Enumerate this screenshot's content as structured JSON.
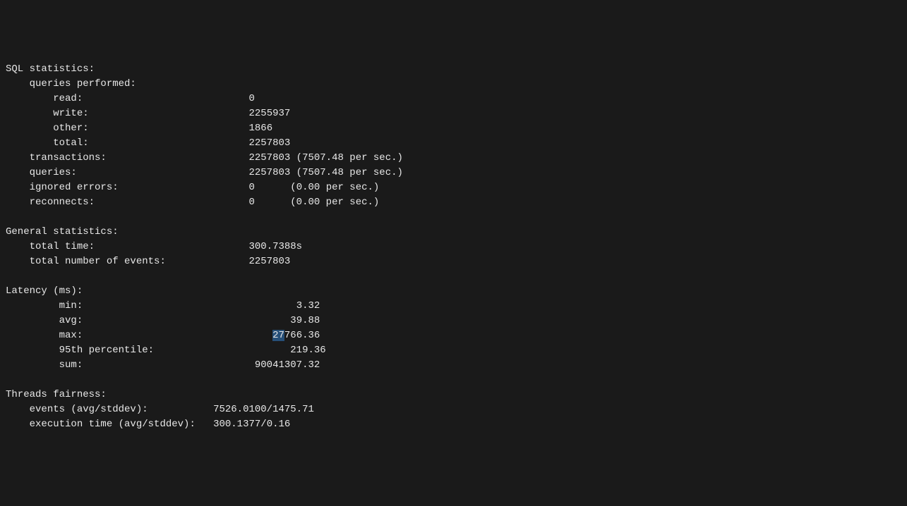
{
  "sql_stats": {
    "header": "SQL statistics:",
    "queries_performed": "queries performed:",
    "read_label": "read:",
    "read_value": "0",
    "write_label": "write:",
    "write_value": "2255937",
    "other_label": "other:",
    "other_value": "1866",
    "total_label": "total:",
    "total_value": "2257803",
    "transactions_label": "transactions:",
    "transactions_value": "2257803 (7507.48 per sec.)",
    "queries_label": "queries:",
    "queries_value": "2257803 (7507.48 per sec.)",
    "ignored_errors_label": "ignored errors:",
    "ignored_errors_value": "0      (0.00 per sec.)",
    "reconnects_label": "reconnects:",
    "reconnects_value": "0      (0.00 per sec.)"
  },
  "general_stats": {
    "header": "General statistics:",
    "total_time_label": "total time:",
    "total_time_value": "300.7388s",
    "total_events_label": "total number of events:",
    "total_events_value": "2257803"
  },
  "latency": {
    "header": "Latency (ms):",
    "min_label": "min:",
    "min_value": "3.32",
    "avg_label": "avg:",
    "avg_value": "39.88",
    "max_label": "max:",
    "max_value_sel": "27",
    "max_value_rest": "766.36",
    "p95_label": "95th percentile:",
    "p95_value": "219.36",
    "sum_label": "sum:",
    "sum_value": "90041307.32"
  },
  "threads": {
    "header": "Threads fairness:",
    "events_label": "events (avg/stddev):",
    "events_value": "7526.0100/1475.71",
    "exec_label": "execution time (avg/stddev):",
    "exec_value": "300.1377/0.16"
  }
}
